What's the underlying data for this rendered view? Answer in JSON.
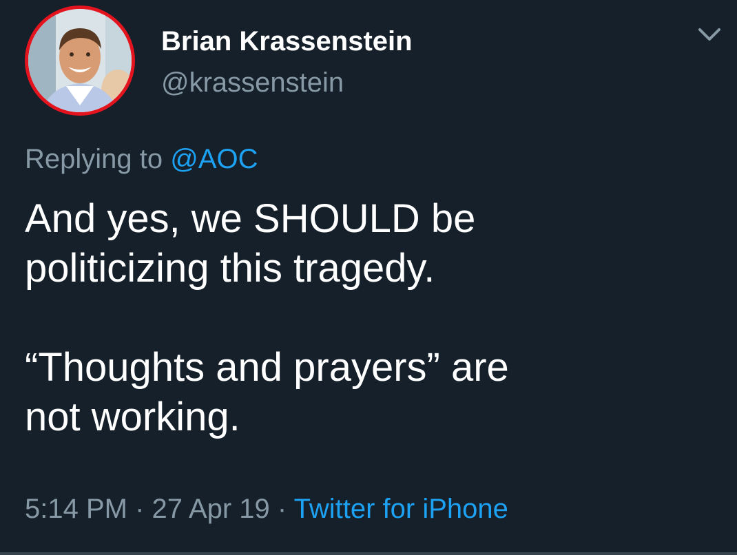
{
  "colors": {
    "background": "#15202b",
    "primary_text": "#ffffff",
    "secondary_text": "#8899a6",
    "link": "#1da1f2",
    "avatar_ring": "#e4141f"
  },
  "author": {
    "display_name": "Brian Krassenstein",
    "handle": "@krassenstein"
  },
  "reply": {
    "prefix": "Replying to",
    "mention": "@AOC"
  },
  "tweet": {
    "paragraph_1_line_1": "And yes, we SHOULD be",
    "paragraph_1_line_2": "politicizing this tragedy.",
    "paragraph_2_line_1": "“Thoughts and prayers” are",
    "paragraph_2_line_2": "not working."
  },
  "meta": {
    "time": "5:14 PM",
    "separator": "·",
    "date": "27 Apr 19",
    "source": "Twitter for iPhone"
  },
  "icons": {
    "menu": "chevron-down-icon",
    "avatar": "profile-photo"
  }
}
